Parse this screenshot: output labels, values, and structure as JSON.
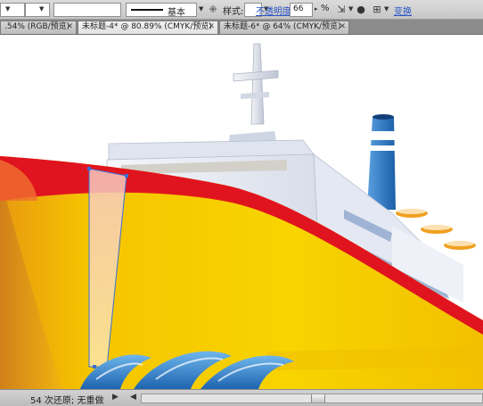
{
  "control_bar": {
    "stroke_style_label": "基本",
    "style_label": "样式:",
    "opacity_label": "不透明度:",
    "opacity_value": "66",
    "opacity_unit": "%",
    "transform_label": "变换",
    "icons": [
      "chevron-down-icon",
      "grid-icon",
      "align-icon",
      "globe-icon",
      "pattern-icon"
    ]
  },
  "tabs": [
    {
      "label": ".54% (RGB/预览)",
      "active": false
    },
    {
      "label": "未标题-4* @ 80.89% (CMYK/预览)",
      "active": true
    },
    {
      "label": "未标题-6* @ 64% (CMYK/预览)",
      "active": false
    }
  ],
  "status_bar": {
    "undo_text": "54 次还原; 无重做"
  },
  "colors": {
    "hull_yellow": "#f5c400",
    "hull_red": "#e0141e",
    "superstructure": "#e8ecf4",
    "window_blue": "#9fb3d4",
    "funnel_blue": "#2470b8",
    "wave_blue": "#2f7cc4",
    "lifeboat_orange": "#f0a020"
  }
}
